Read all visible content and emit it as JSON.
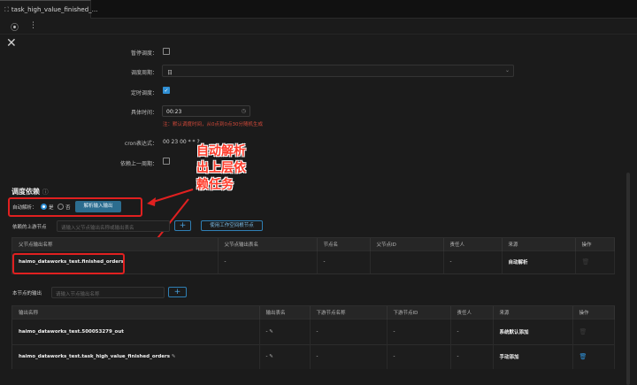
{
  "tab": {
    "title": "task_high_value_finished_..."
  },
  "schedule": {
    "pause_label": "暂停调度：",
    "period_label": "调度周期：",
    "period_value": "日",
    "timed_label": "定时调度：",
    "time_label": "具体时间：",
    "time_value": "00:23",
    "time_hint": "注：默认调度时间，从0点到0点30分随机生成",
    "cron_label": "cron表达式：",
    "cron_value": "00 23 00 * * ?",
    "prev_cycle_label": "依赖上一周期："
  },
  "annotation": {
    "line1": "自动解析",
    "line2": "出上层依",
    "line3": "赖任务"
  },
  "deps": {
    "title": "调度依赖",
    "auto_parse_label": "自动解析：",
    "yes": "是",
    "no": "否",
    "parse_button": "解析输入输出",
    "upstream_label": "依赖的上游节点",
    "upstream_placeholder": "请输入父节点输出名称或输出表名",
    "plus": "+",
    "use_root_button": "使用工作空间根节点",
    "upstream_columns": [
      "父节点输出名称",
      "父节点输出表名",
      "节点名",
      "父节点ID",
      "责任人",
      "来源",
      "操作"
    ],
    "upstream_rows": [
      {
        "name": "haimo_dataworks_test.finished_orders",
        "table": "-",
        "node": "-",
        "id": "",
        "owner": "-",
        "source": "自动解析"
      }
    ],
    "output_label": "本节点的输出",
    "output_placeholder": "请输入节点输出名称",
    "output_columns": [
      "输出名称",
      "输出表名",
      "下游节点名称",
      "下游节点ID",
      "责任人",
      "来源",
      "操作"
    ],
    "output_rows": [
      {
        "name": "haimo_dataworks_test.500053279_out",
        "table": "-",
        "node": "-",
        "id": "-",
        "owner": "-",
        "source": "系统默认添加"
      },
      {
        "name": "haimo_dataworks_test.task_high_value_finished_orders",
        "table": "-",
        "node": "-",
        "id": "-",
        "owner": "-",
        "source": "手动添加"
      }
    ]
  }
}
